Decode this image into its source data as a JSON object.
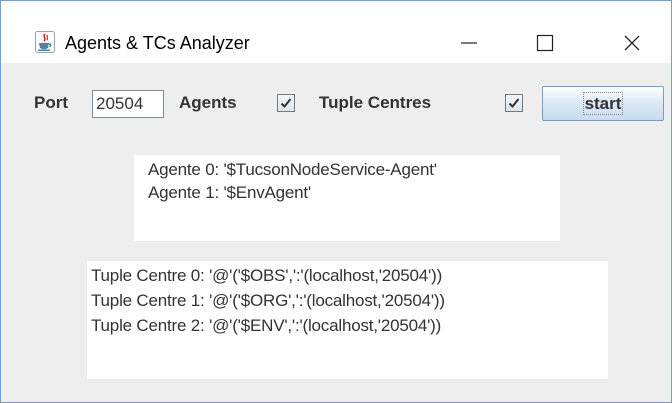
{
  "window": {
    "title": "Agents & TCs Analyzer",
    "controls": {
      "minimize": "—",
      "maximize": "☐",
      "close": "✕"
    }
  },
  "toolbar": {
    "port_label": "Port",
    "port_value": "20504",
    "agents_label": "Agents",
    "agents_checked": true,
    "tuple_centres_label": "Tuple Centres",
    "tuple_centres_checked": true,
    "start_label": "start"
  },
  "agents_panel": {
    "lines": [
      "Agente 0: '$TucsonNodeService-Agent'",
      "Agente 1: '$EnvAgent'"
    ]
  },
  "tuple_centres_panel": {
    "lines": [
      "Tuple Centre 0: '@'('$OBS',':'(localhost,'20504'))",
      "Tuple Centre 1: '@'('$ORG',':'(localhost,'20504'))",
      "Tuple Centre 2: '@'('$ENV',':'(localhost,'20504'))"
    ]
  },
  "colors": {
    "window_bg": "#eeeeee",
    "titlebar_bg": "#ffffff",
    "panel_bg": "#ffffff",
    "text": "#333333",
    "button_gradient_bottom": "#c8dcef"
  },
  "icons": {
    "app": "java-cup-icon",
    "checkbox_mark": "check-icon"
  }
}
